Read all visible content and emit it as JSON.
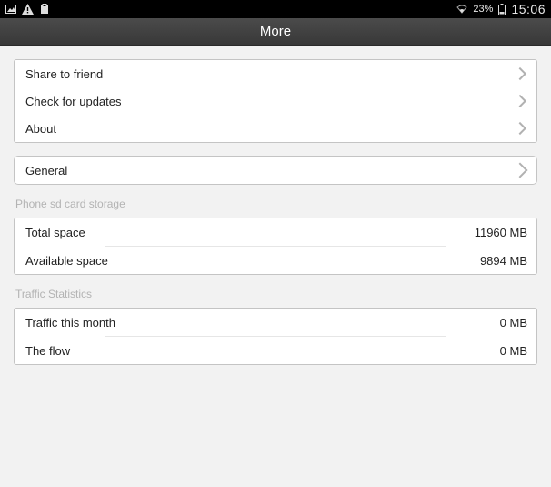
{
  "status": {
    "battery_pct": "23%",
    "clock": "15:06"
  },
  "title": "More",
  "main_items": {
    "share": "Share to friend",
    "updates": "Check for updates",
    "about": "About"
  },
  "general": {
    "label": "General"
  },
  "storage": {
    "header": "Phone sd card storage",
    "total_label": "Total space",
    "total_value": "11960 MB",
    "avail_label": "Available space",
    "avail_value": "9894 MB"
  },
  "traffic": {
    "header": "Traffic Statistics",
    "month_label": "Traffic this month",
    "month_value": "0 MB",
    "flow_label": "The flow",
    "flow_value": "0 MB"
  }
}
